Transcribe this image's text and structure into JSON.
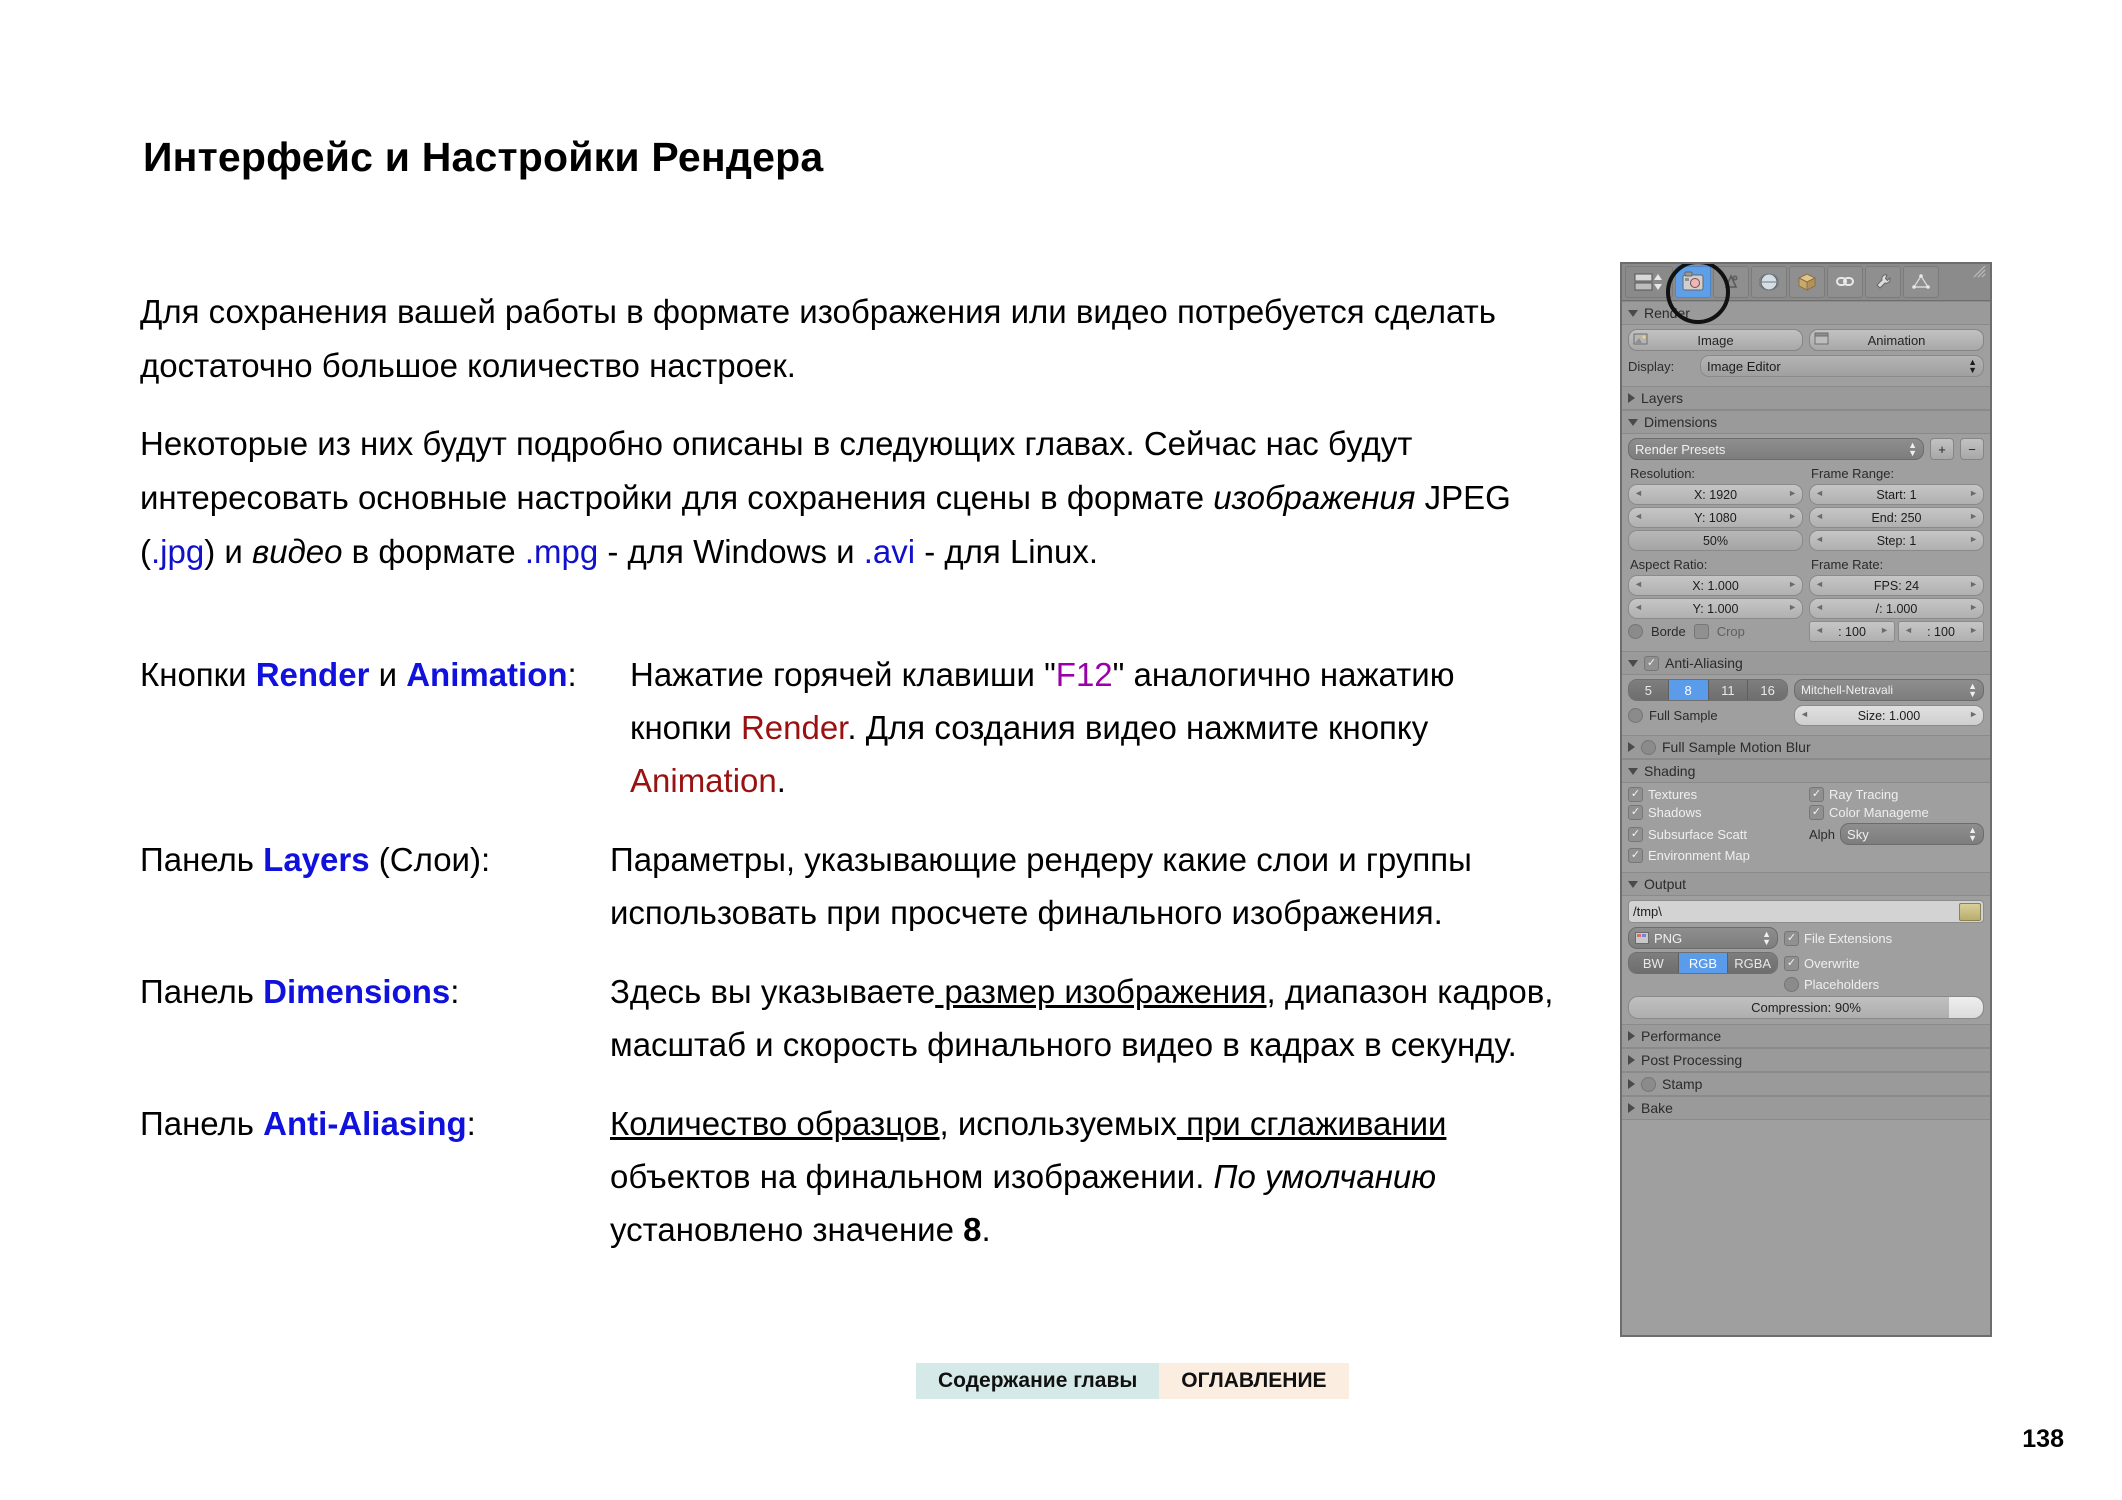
{
  "page": {
    "title": "Интерфейс и Настройки Рендера",
    "number": "138"
  },
  "intro": {
    "para1": "Для сохранения вашей работы в формате изображения или видео потребуется сделать достаточно большое количество настроек.",
    "para2_a": "Некоторые из них будут подробно описаны в следующих главах. Сейчас нас будут интересовать основные настройки для сохранения сцены в формате ",
    "para2_italic": "изображения",
    "para2_b": " JPEG (",
    "ext_jpg": ".jpg",
    "para2_c": ") и ",
    "para2_italic2": "видео",
    "para2_d": " в формате ",
    "ext_mpg": ".mpg",
    "para2_e": " - для Windows и ",
    "ext_avi": ".avi",
    "para2_f": " - для Linux."
  },
  "definitions": [
    {
      "term_prefix": "Кнопки ",
      "term_kw1": "Render",
      "term_mid": " и ",
      "term_kw2": "Animation",
      "term_suffix": ":",
      "desc_a": "Нажатие горячей клавиши \"",
      "desc_key": "F12",
      "desc_b": "\" аналогично нажатию кнопки ",
      "desc_red1": "Render",
      "desc_c": ". Для создания видео нажмите кнопку ",
      "desc_red2": "Animation",
      "desc_d": "."
    },
    {
      "term_prefix": "Панель ",
      "term_kw1": "Layers",
      "term_suffix": " (Слои):",
      "desc_a": "Параметры, указывающие рендеру какие слои и группы использовать при просчете финального изображения."
    },
    {
      "term_prefix": "Панель ",
      "term_kw1": "Dimensions",
      "term_suffix": ":",
      "desc_a": "Здесь вы указываете",
      "desc_underline": " размер изображения",
      "desc_b": ", диапазон кадров, масштаб и скорость финального видео в кадрах в секунду."
    },
    {
      "term_prefix": "Панель ",
      "term_kw1": "Anti-Aliasing",
      "term_suffix": ":",
      "desc_underline1": "Количество образцов",
      "desc_a": ", используемых",
      "desc_underline2": " при сглаживании",
      "desc_b": " объектов на финальном изображении. ",
      "desc_italic": "По умолчанию",
      "desc_c": " установлено значение ",
      "desc_bold": "8",
      "desc_d": "."
    }
  ],
  "footer": {
    "chapter_label": "Содержание главы",
    "toc_label": "ОГЛАВЛЕНИЕ"
  },
  "blender": {
    "tabs": [
      {
        "name": "editor-type",
        "icon": "editor-select-icon"
      },
      {
        "name": "render",
        "icon": "camera-back-icon",
        "active": true
      },
      {
        "name": "scene",
        "icon": "scene-icon"
      },
      {
        "name": "world",
        "icon": "world-globe-icon"
      },
      {
        "name": "object",
        "icon": "object-cube-icon"
      },
      {
        "name": "constraints",
        "icon": "chain-link-icon"
      },
      {
        "name": "modifiers",
        "icon": "wrench-icon"
      },
      {
        "name": "data",
        "icon": "mesh-data-icon"
      }
    ],
    "render_section": {
      "title": "Render",
      "image_button": "Image",
      "animation_button": "Animation",
      "display_label": "Display:",
      "display_value": "Image Editor"
    },
    "layers_section": {
      "title": "Layers"
    },
    "dimensions_section": {
      "title": "Dimensions",
      "presets": "Render Presets",
      "resolution_label": "Resolution:",
      "res_x": "X: 1920",
      "res_y": "Y: 1080",
      "res_percent": "50%",
      "frame_range_label": "Frame Range:",
      "frame_start": "Start: 1",
      "frame_end": "End: 250",
      "frame_step": "Step: 1",
      "aspect_label": "Aspect Ratio:",
      "aspect_x": "X: 1.000",
      "aspect_y": "Y: 1.000",
      "frame_rate_label": "Frame Rate:",
      "fps": "FPS: 24",
      "fps_base": "/: 1.000",
      "map_old": ": 100",
      "map_new": ": 100",
      "border_label": "Borde",
      "crop_label": "Crop"
    },
    "aa_section": {
      "title": "Anti-Aliasing",
      "samples": [
        "5",
        "8",
        "11",
        "16"
      ],
      "selected_sample": "8",
      "filter": "Mitchell-Netravali",
      "full_sample": "Full Sample",
      "size": "Size: 1.000"
    },
    "motion_blur_section": {
      "title": "Full Sample Motion Blur"
    },
    "shading_section": {
      "title": "Shading",
      "textures": "Textures",
      "shadows": "Shadows",
      "subsurface": "Subsurface Scatt",
      "environment": "Environment Map",
      "ray_tracing": "Ray Tracing",
      "color_management": "Color Manageme",
      "alpha_label": "Alph",
      "alpha_value": "Sky"
    },
    "output_section": {
      "title": "Output",
      "path": "/tmp\\",
      "format": "PNG",
      "color_modes": [
        "BW",
        "RGB",
        "RGBA"
      ],
      "selected_color_mode": "RGB",
      "file_extensions": "File Extensions",
      "overwrite": "Overwrite",
      "placeholders": "Placeholders",
      "compression": "Compression: 90%"
    },
    "collapsed_sections": [
      {
        "title": "Performance",
        "has_checkbox": false
      },
      {
        "title": "Post Processing",
        "has_checkbox": false
      },
      {
        "title": "Stamp",
        "has_checkbox": true
      },
      {
        "title": "Bake",
        "has_checkbox": false
      }
    ]
  }
}
